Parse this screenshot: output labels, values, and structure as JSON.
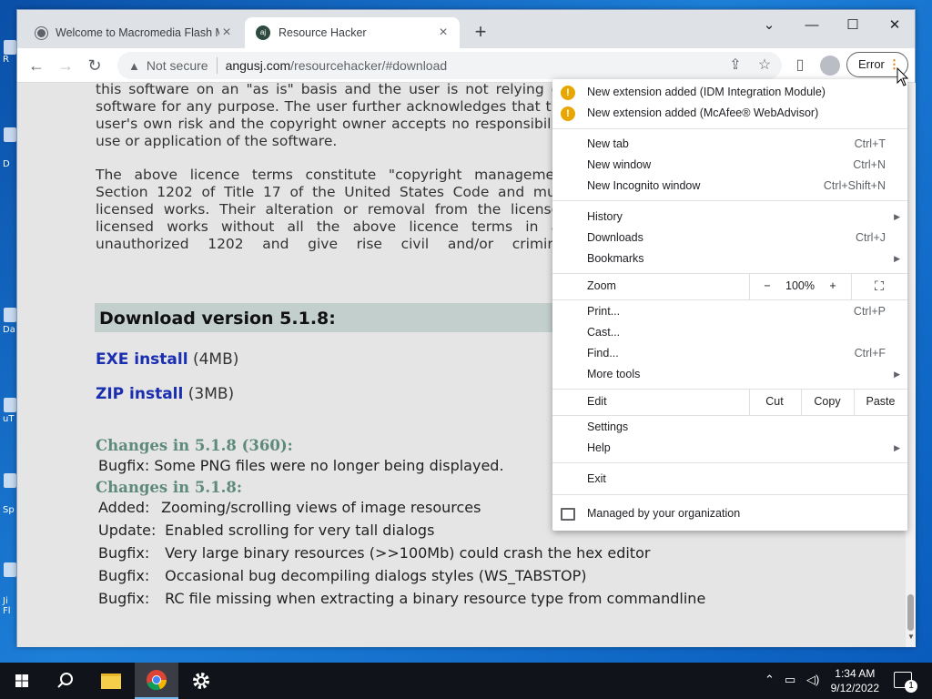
{
  "desktop": {
    "icon_labels": [
      "R",
      "D",
      "Da",
      "uT",
      "Sp",
      "Ji\nFl"
    ]
  },
  "tabs": [
    {
      "title": "Welcome to Macromedia Flash M",
      "active": false
    },
    {
      "title": "Resource Hacker",
      "active": true
    }
  ],
  "window_controls": {
    "dropdown": "⌄",
    "minimize": "—",
    "maximize": "☐",
    "close": "✕"
  },
  "address_bar": {
    "security_label": "Not secure",
    "url_host": "angusj.com",
    "url_path": "/resourcehacker/#download"
  },
  "toolbar": {
    "error_label": "Error",
    "menu_dots": "⋮"
  },
  "page": {
    "para1": "this software on an \"as is\" basis and the user is not relying on software for any purpose. The user further acknowledges that the user's own risk and the copyright owner accepts no responsibility use or application of the software.",
    "para2": "The above licence terms constitute \"copyright management Section 1202 of Title 17 of the United States Code and must licensed works. Their alteration or removal from the licensed licensed works without all the above licence terms in an unauthorized 1202 and give rise civil and/or criminal consequences.",
    "download_heading": "Download version 5.1.8:",
    "exe_link": "EXE install",
    "exe_size": "(4MB)",
    "zip_link": "ZIP install",
    "zip_size": "(3MB)",
    "changes_360_heading": "Changes in 5.1.8 (360):",
    "changes_360": [
      {
        "tag": "Bugfix:",
        "text": "Some PNG files were no longer being displayed."
      }
    ],
    "changes_heading": "Changes in 5.1.8:",
    "changes": [
      {
        "tag": "Added:",
        "text": "Zooming/scrolling views of image resources"
      },
      {
        "tag": "Update:",
        "text": "Enabled scrolling for very tall dialogs"
      },
      {
        "tag": "Bugfix:",
        "text": "Very large binary resources (>>100Mb) could crash the hex editor"
      },
      {
        "tag": "Bugfix:",
        "text": "Occasional bug decompiling dialogs styles (WS_TABSTOP)"
      },
      {
        "tag": "Bugfix:",
        "text": "RC file missing when extracting a binary resource type from commandline"
      }
    ]
  },
  "menu": {
    "extensions": [
      "New extension added (IDM Integration Module)",
      "New extension added (McAfee® WebAdvisor)"
    ],
    "new_tab": {
      "label": "New tab",
      "shortcut": "Ctrl+T"
    },
    "new_window": {
      "label": "New window",
      "shortcut": "Ctrl+N"
    },
    "new_incognito": {
      "label": "New Incognito window",
      "shortcut": "Ctrl+Shift+N"
    },
    "history": {
      "label": "History"
    },
    "downloads": {
      "label": "Downloads",
      "shortcut": "Ctrl+J"
    },
    "bookmarks": {
      "label": "Bookmarks"
    },
    "zoom": {
      "label": "Zoom",
      "minus": "−",
      "level": "100%",
      "plus": "+"
    },
    "print": {
      "label": "Print...",
      "shortcut": "Ctrl+P"
    },
    "cast": {
      "label": "Cast..."
    },
    "find": {
      "label": "Find...",
      "shortcut": "Ctrl+F"
    },
    "more_tools": {
      "label": "More tools"
    },
    "edit": {
      "label": "Edit",
      "cut": "Cut",
      "copy": "Copy",
      "paste": "Paste"
    },
    "settings": {
      "label": "Settings"
    },
    "help": {
      "label": "Help"
    },
    "exit": {
      "label": "Exit"
    },
    "managed": {
      "label": "Managed by your organization"
    }
  },
  "taskbar": {
    "time": "1:34 AM",
    "date": "9/12/2022",
    "notification_count": "1"
  }
}
